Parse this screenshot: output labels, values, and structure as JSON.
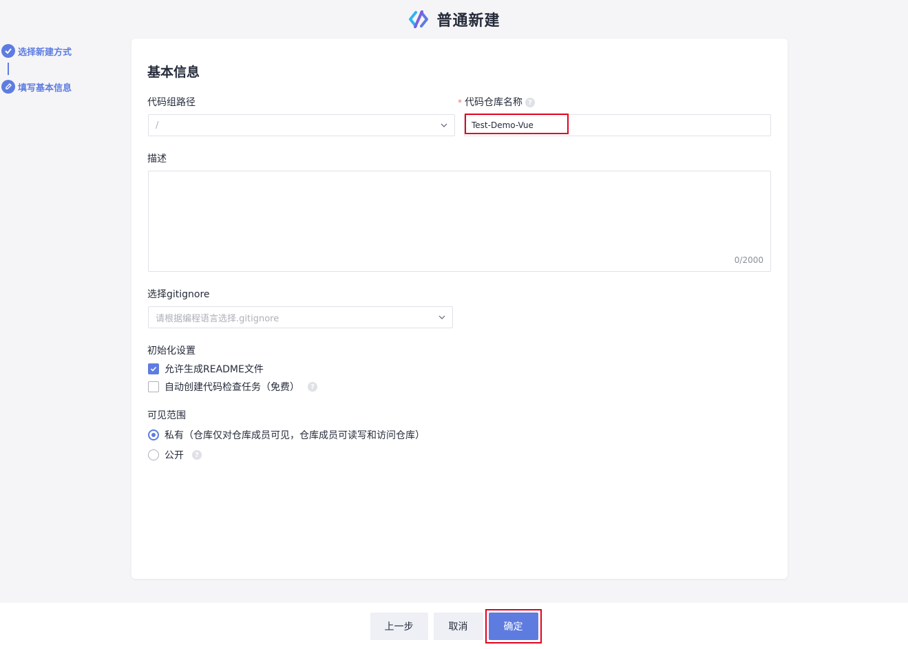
{
  "header": {
    "title": "普通新建"
  },
  "steps": [
    {
      "label": "选择新建方式",
      "status": "done"
    },
    {
      "label": "填写基本信息",
      "status": "current"
    }
  ],
  "form": {
    "section_title": "基本信息",
    "group_path": {
      "label": "代码组路径",
      "value": "/"
    },
    "repo_name": {
      "required_mark": "*",
      "label": "代码仓库名称",
      "value": "Test-Demo-Vue"
    },
    "description": {
      "label": "描述",
      "value": "",
      "counter": "0/2000"
    },
    "gitignore": {
      "label": "选择gitignore",
      "placeholder": "请根据编程语言选择.gitignore"
    },
    "init": {
      "label": "初始化设置",
      "readme": {
        "label": "允许生成README文件",
        "checked": true
      },
      "code_check": {
        "label": "自动创建代码检查任务（免费）",
        "checked": false
      }
    },
    "visibility": {
      "label": "可见范围",
      "private": {
        "label": "私有（仓库仅对仓库成员可见，仓库成员可读写和访问仓库）",
        "selected": true
      },
      "public": {
        "label": "公开",
        "selected": false
      }
    }
  },
  "footer": {
    "prev_label": "上一步",
    "cancel_label": "取消",
    "confirm_label": "确定"
  },
  "colors": {
    "accent": "#5e7ce0",
    "highlight": "#e0001b"
  }
}
